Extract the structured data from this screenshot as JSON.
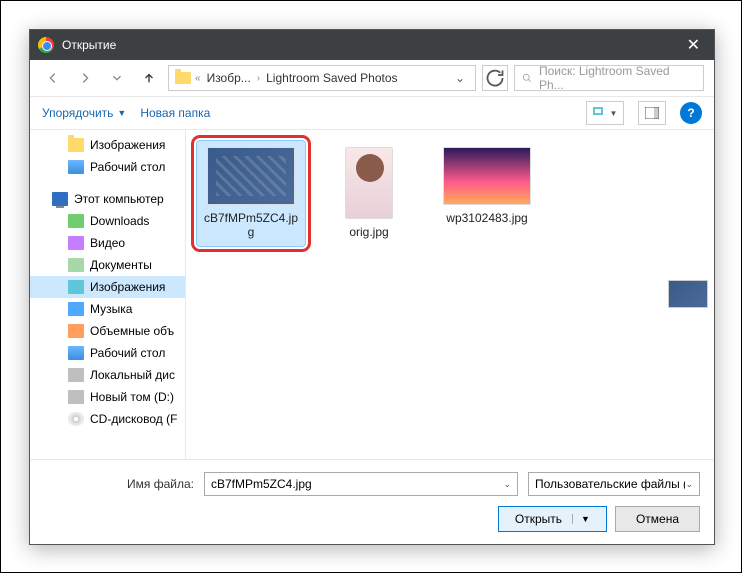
{
  "titlebar": {
    "title": "Открытие"
  },
  "nav": {
    "crumb1": "Изобр...",
    "crumb2": "Lightroom Saved Photos",
    "search_placeholder": "Поиск: Lightroom Saved Ph..."
  },
  "toolbar": {
    "organize": "Упорядочить",
    "newfolder": "Новая папка"
  },
  "sidebar": {
    "items": [
      {
        "label": "Изображения",
        "icon": "ico-folder",
        "level": 1
      },
      {
        "label": "Рабочий стол",
        "icon": "ico-desktop",
        "level": 1
      },
      {
        "sep": true
      },
      {
        "label": "Этот компьютер",
        "icon": "ico-pc",
        "level": 0
      },
      {
        "label": "Downloads",
        "icon": "ico-down",
        "level": 1
      },
      {
        "label": "Видео",
        "icon": "ico-video",
        "level": 1
      },
      {
        "label": "Документы",
        "icon": "ico-doc",
        "level": 1
      },
      {
        "label": "Изображения",
        "icon": "ico-img",
        "level": 1,
        "selected": true
      },
      {
        "label": "Музыка",
        "icon": "ico-music",
        "level": 1
      },
      {
        "label": "Объемные объ",
        "icon": "ico-3d",
        "level": 1
      },
      {
        "label": "Рабочий стол",
        "icon": "ico-desktop",
        "level": 1
      },
      {
        "label": "Локальный дис",
        "icon": "ico-disk",
        "level": 1
      },
      {
        "label": "Новый том (D:)",
        "icon": "ico-disk",
        "level": 1
      },
      {
        "label": "CD-дисковод (F",
        "icon": "ico-cd",
        "level": 1
      }
    ]
  },
  "files": [
    {
      "name": "cB7fMPm5ZC4.jpg",
      "thumb": "t1",
      "selected": true,
      "highlight": true
    },
    {
      "name": "orig.jpg",
      "thumb": "t2"
    },
    {
      "name": "wp3102483.jpg",
      "thumb": "t3"
    }
  ],
  "footer": {
    "filename_label": "Имя файла:",
    "filename_value": "cB7fMPm5ZC4.jpg",
    "filter": "Пользовательские файлы (*.jp",
    "open": "Открыть",
    "cancel": "Отмена"
  }
}
